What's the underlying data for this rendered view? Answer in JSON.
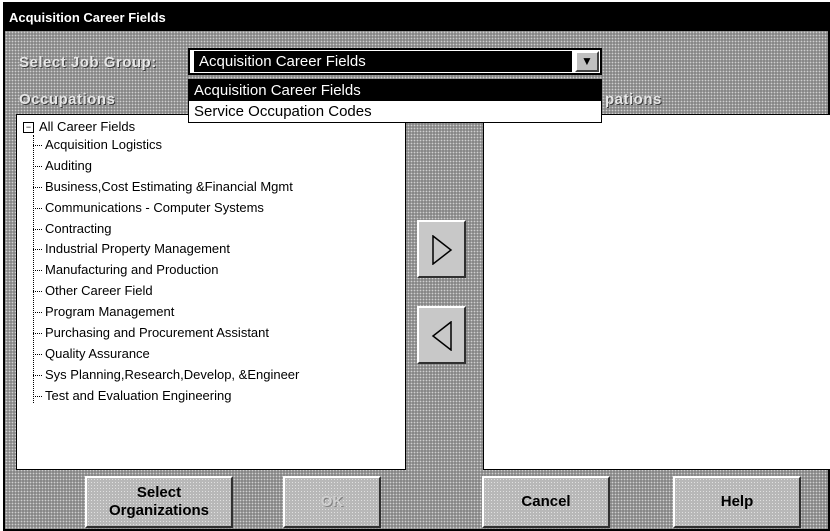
{
  "window": {
    "title": "Acquisition Career Fields"
  },
  "job_group": {
    "label": "Select Job Group:",
    "selected": "Acquisition Career Fields",
    "options": [
      "Acquisition Career Fields",
      "Service Occupation Codes"
    ]
  },
  "occupations": {
    "label": "Occupations",
    "root": "All Career Fields",
    "items": [
      "Acquisition Logistics",
      "Auditing",
      "Business,Cost Estimating &Financial Mgmt",
      "Communications - Computer Systems",
      "Contracting",
      "Industrial Property Management",
      "Manufacturing and Production",
      "Other Career Field",
      "Program Management",
      "Purchasing and Procurement Assistant",
      "Quality Assurance",
      "Sys Planning,Research,Develop, &Engineer",
      "Test and Evaluation Engineering"
    ]
  },
  "selected_occupations": {
    "label_visible": "pations"
  },
  "buttons": {
    "select_orgs": "Select\nOrganizations",
    "ok": "OK",
    "cancel": "Cancel",
    "help": "Help"
  },
  "icons": {
    "add": "arrow-right-icon",
    "remove": "arrow-left-icon",
    "dropdown": "chevron-down-icon",
    "collapse": "tree-collapse-icon"
  }
}
